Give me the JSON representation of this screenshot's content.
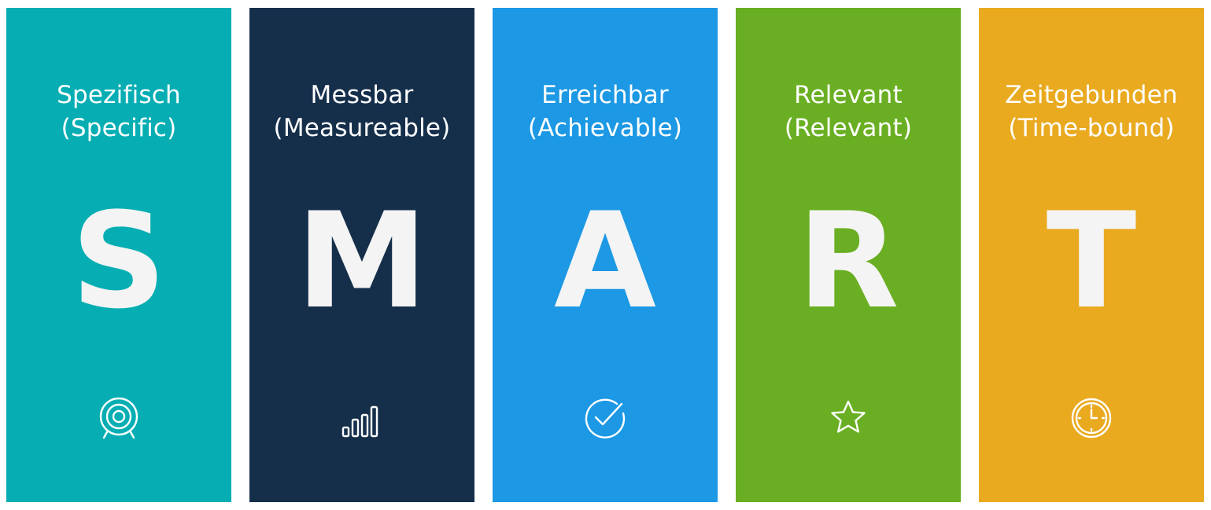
{
  "panels": [
    {
      "line1": "Spezifisch",
      "line2": "(Specific)",
      "letter": "S",
      "icon": "target-icon",
      "color": "#06aeb3"
    },
    {
      "line1": "Messbar",
      "line2": "(Measureable)",
      "letter": "M",
      "icon": "bar-chart-icon",
      "color": "#152f4b"
    },
    {
      "line1": "Erreichbar",
      "line2": "(Achievable)",
      "letter": "A",
      "icon": "check-circle-icon",
      "color": "#1c98e4"
    },
    {
      "line1": "Relevant",
      "line2": "(Relevant)",
      "letter": "R",
      "icon": "star-icon",
      "color": "#6aaf23"
    },
    {
      "line1": "Zeitgebunden",
      "line2": "(Time-bound)",
      "letter": "T",
      "icon": "clock-icon",
      "color": "#e9aa20"
    }
  ]
}
